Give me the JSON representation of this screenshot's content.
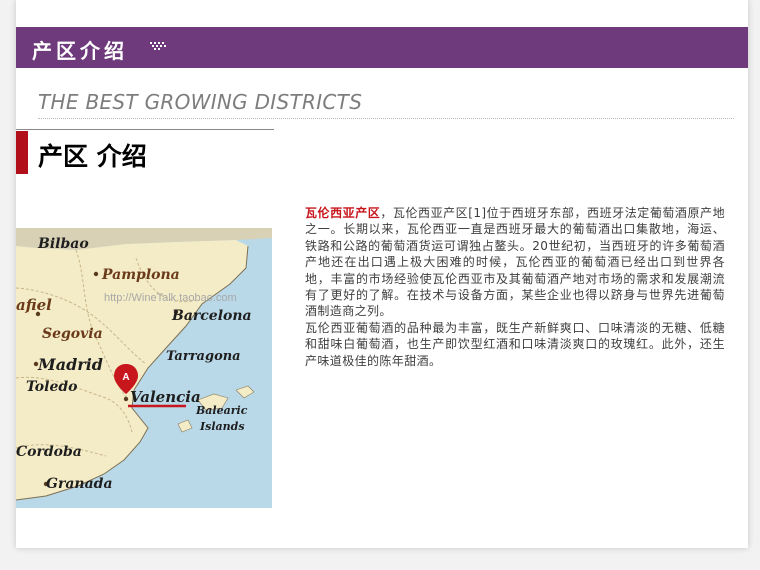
{
  "header": {
    "title": "产区介绍",
    "colors": {
      "banner": "#6e3a7c",
      "marker": "#b10f19",
      "lead_text": "#c8161d"
    }
  },
  "subtitle": {
    "english": "THE BEST GROWING DISTRICTS"
  },
  "section": {
    "title": "产区 介绍"
  },
  "map": {
    "watermark": "http://WineTalk.taobao.com",
    "pin_label": "A",
    "cities": {
      "bilbao": "Bilbao",
      "pamplona": "Pamplona",
      "afiel": "afiel",
      "segovia": "Segovia",
      "barcelona": "Barcelona",
      "madrid": "Madrid",
      "tarragona": "Tarragona",
      "toledo": "Toledo",
      "valencia": "Valencia",
      "balearic": "Balearic",
      "islands": "Islands",
      "cordoba": "Cordoba",
      "granada": "Granada"
    }
  },
  "article": {
    "lead": "瓦伦西亚产区",
    "paragraph1": "，瓦伦西亚产区[1]位于西班牙东部，西班牙法定葡萄酒原产地之一。长期以来，瓦伦西亚一直是西班牙最大的葡萄酒出口集散地，海运、铁路和公路的葡萄酒货运可谓独占鳌头。20世纪初，当西班牙的许多葡萄酒产地还在出口遇上极大困难的时候，瓦伦西亚的葡萄酒已经出口到世界各地，丰富的市场经验使瓦伦西亚市及其葡萄酒产地对市场的需求和发展潮流有了更好的了解。在技术与设备方面，某些企业也得以跻身与世界先进葡萄酒制造商之列。",
    "paragraph2": "瓦伦西亚葡萄酒的品种最为丰富，既生产新鲜爽口、口味清淡的无糖、低糖和甜味白葡萄酒，也生产即饮型红酒和口味清淡爽口的玫瑰红。此外，还生产味道极佳的陈年甜酒。"
  }
}
